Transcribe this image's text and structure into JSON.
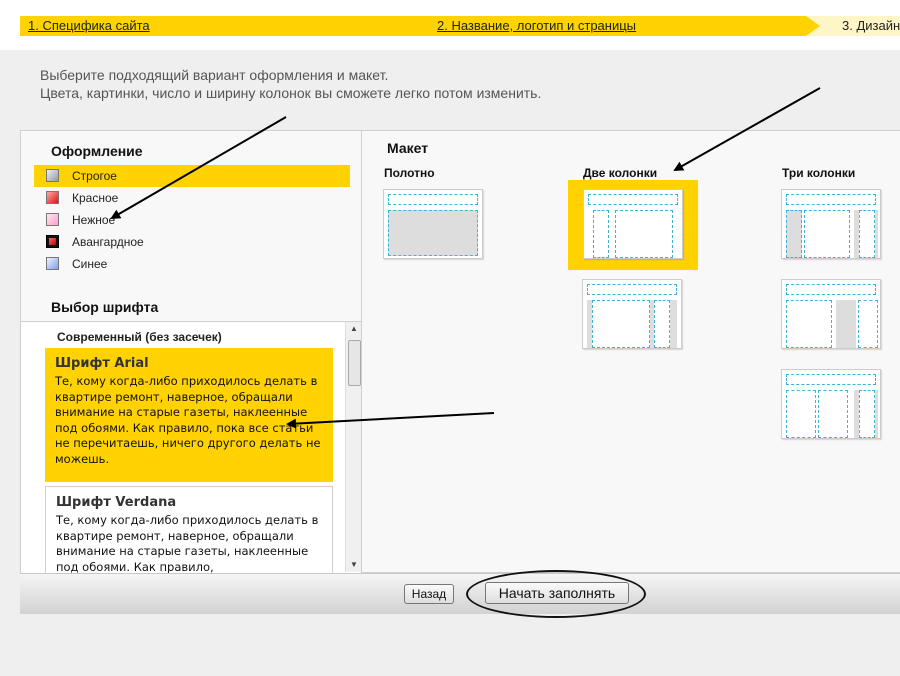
{
  "steps": {
    "step1": "1. Специфика сайта",
    "step2": "2. Название, логотип и страницы",
    "step3": "3. Дизайн"
  },
  "intro": {
    "line1": "Выберите подходящий вариант оформления и макет.",
    "line2": "Цвета, картинки, число и ширину колонок вы сможете легко потом изменить."
  },
  "theme": {
    "title": "Оформление",
    "items": [
      {
        "label": "Строгое",
        "color": "#c8c8c8"
      },
      {
        "label": "Красное",
        "color": "#ee3333"
      },
      {
        "label": "Нежное",
        "color": "#ffb8d8"
      },
      {
        "label": "Авангардное",
        "color": "#cc1111"
      },
      {
        "label": "Синее",
        "color": "#8aa8e8"
      }
    ],
    "selected": "Строгое"
  },
  "font": {
    "title": "Выбор шрифта",
    "group": "Современный (без засечек)",
    "cards": [
      {
        "name": "Шрифт Arial",
        "sample": "Те, кому когда-либо приходилось делать в квартире ремонт, наверное, обращали внимание на старые газеты, наклеенные под обоями. Как правило, пока все статьи не перечитаешь, ничего другого делать не можешь."
      },
      {
        "name": "Шрифт Verdana",
        "sample": "Те, кому когда-либо приходилось делать в квартире ремонт, наверное, обращали внимание на старые газеты, наклеенные под обоями. Как правило,"
      }
    ],
    "selected": "Шрифт Arial"
  },
  "layout": {
    "title": "Макет",
    "col1": "Полотно",
    "col2": "Две колонки",
    "col3": "Три колонки",
    "selected": "Две колонки"
  },
  "buttons": {
    "back": "Назад",
    "start": "Начать заполнять"
  },
  "colors": {
    "accent": "#ffd200",
    "guide": "#3fb4d4"
  }
}
